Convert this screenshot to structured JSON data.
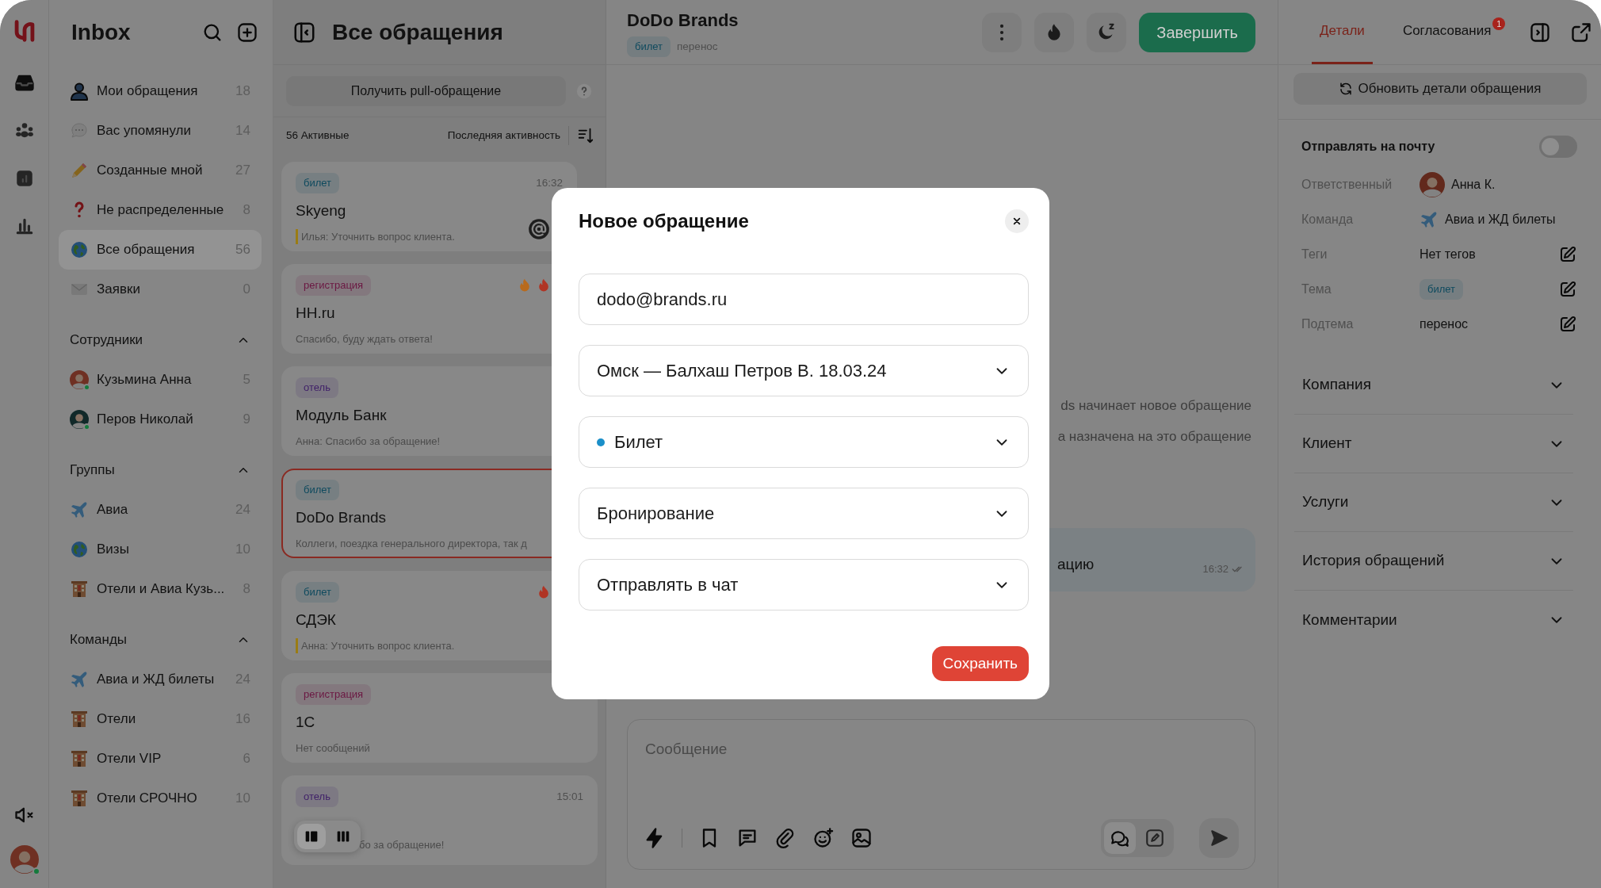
{
  "rail": {
    "user_online": true
  },
  "sidebar": {
    "title": "Inbox",
    "items": [
      {
        "label": "Мои обращения",
        "count": "18",
        "selected": false
      },
      {
        "label": "Вас упомянули",
        "count": "14",
        "selected": false
      },
      {
        "label": "Созданные мной",
        "count": "27",
        "selected": false
      },
      {
        "label": "Не распределенные",
        "count": "8",
        "selected": false
      },
      {
        "label": "Все обращения",
        "count": "56",
        "selected": true
      },
      {
        "label": "Заявки",
        "count": "0",
        "selected": false
      }
    ],
    "sections": [
      {
        "title": "Сотрудники",
        "expanded": true,
        "items": [
          {
            "label": "Кузьмина Анна",
            "count": "5",
            "online": true
          },
          {
            "label": "Перов Николай",
            "count": "9",
            "online": true
          }
        ]
      },
      {
        "title": "Группы",
        "expanded": true,
        "items": [
          {
            "label": "Авиа",
            "count": "24"
          },
          {
            "label": "Визы",
            "count": "10"
          },
          {
            "label": "Отели и Авиа Кузь...",
            "count": "8"
          }
        ]
      },
      {
        "title": "Команды",
        "expanded": true,
        "items": [
          {
            "label": "Авиа и ЖД билеты",
            "count": "24"
          },
          {
            "label": "Отели",
            "count": "16"
          },
          {
            "label": "Отели VIP",
            "count": "6"
          },
          {
            "label": "Отели СРОЧНО",
            "count": "10"
          }
        ]
      }
    ]
  },
  "list": {
    "title": "Все обращения",
    "pull_button": "Получить pull-обращение",
    "active_count": "56 Активные",
    "sort_label": "Последняя активность",
    "cards": [
      {
        "tag": {
          "text": "билет",
          "color": "#0e4a5e"
        },
        "time": "16:32",
        "title": "Skyeng",
        "preview": "Илья: Уточнить вопрос клиента.",
        "marked": true,
        "mention": true,
        "selected": false
      },
      {
        "tag": {
          "text": "регистрация",
          "color": "#6b1742"
        },
        "title": "HH.ru",
        "preview": "Спасибо, буду ждать ответа!",
        "marked": false,
        "mention": false,
        "flames": [
          {
            "color": "#b86a1c"
          },
          {
            "color": "#b03424"
          }
        ],
        "selected": false
      },
      {
        "tag": {
          "text": "отель",
          "color": "#3f1f68"
        },
        "title": "Модуль Банк",
        "preview": "Анна: Спасибо за обращение!",
        "marked": false,
        "mention": false,
        "selected": false
      },
      {
        "tag": {
          "text": "билет",
          "color": "#0e4a5e"
        },
        "title": "DoDo Brands",
        "preview": "Коллеги, поездка генерального директора, так д",
        "marked": false,
        "mention": false,
        "selected": true
      },
      {
        "tag": {
          "text": "билет",
          "color": "#0e4a5e"
        },
        "title": "СДЭК",
        "preview": "Анна: Уточнить вопрос клиента.",
        "marked": true,
        "mention": false,
        "flames": [
          {
            "color": "#b03424"
          }
        ],
        "selected": false
      },
      {
        "tag": {
          "text": "регистрация",
          "color": "#6b1742"
        },
        "title": "1С",
        "preview": "Нет сообщений",
        "marked": false,
        "mention": false,
        "selected": false
      },
      {
        "tag": {
          "text": "отель",
          "color": "#3f1f68"
        },
        "time": "15:01",
        "preview": "бо за обращение!",
        "marked": false,
        "mention": false,
        "selected": false
      }
    ],
    "view_toggle": [
      {
        "selected": true
      },
      {
        "selected": false
      }
    ]
  },
  "chat": {
    "title": "DoDo Brands",
    "tag": {
      "text": "билет",
      "color": "#0e4a5e"
    },
    "subtopic": "перенос",
    "finish_button": "Завершить",
    "events": [
      "ds начинает новое обращение",
      "а назначена на это обращение"
    ],
    "message": {
      "text": "ацию",
      "time": "16:32",
      "read": true
    },
    "composer": {
      "placeholder": "Сообщение",
      "modes": [
        {
          "selected": true
        },
        {
          "selected": false
        }
      ]
    }
  },
  "details": {
    "tabs": [
      {
        "label": "Детали",
        "selected": true
      },
      {
        "label": "Согласования",
        "selected": false,
        "badge": "1"
      }
    ],
    "refresh_button": "Обновить детали обращения",
    "email_toggle": {
      "label": "Отправлять на почту",
      "on": false
    },
    "fields": [
      {
        "label": "Ответственный",
        "kind": "person",
        "value": "Анна К."
      },
      {
        "label": "Команда",
        "kind": "team",
        "value": "Авиа и ЖД билеты"
      },
      {
        "label": "Теги",
        "kind": "text",
        "value": "Нет тегов",
        "editable": true
      },
      {
        "label": "Тема",
        "kind": "tag",
        "value": "билет",
        "color": "#0e4a5e",
        "editable": true
      },
      {
        "label": "Подтема",
        "kind": "text",
        "value": "перенос",
        "editable": true
      }
    ],
    "sections": [
      {
        "title": "Компания",
        "expanded": false
      },
      {
        "title": "Клиент",
        "expanded": false
      },
      {
        "title": "Услуги",
        "expanded": false
      },
      {
        "title": "История обращений",
        "expanded": false
      },
      {
        "title": "Комментарии",
        "expanded": false
      }
    ]
  },
  "modal": {
    "title": "Новое обращение",
    "fields": [
      {
        "kind": "input",
        "value": "dodo@brands.ru"
      },
      {
        "kind": "select",
        "value": "Омск — Балхаш Петров В. 18.03.24"
      },
      {
        "kind": "select",
        "value": "Билет",
        "color": "#1b8fc9"
      },
      {
        "kind": "select",
        "value": "Бронирование"
      },
      {
        "kind": "select",
        "value": "Отправлять в чат"
      }
    ],
    "save_button": "Сохранить"
  }
}
